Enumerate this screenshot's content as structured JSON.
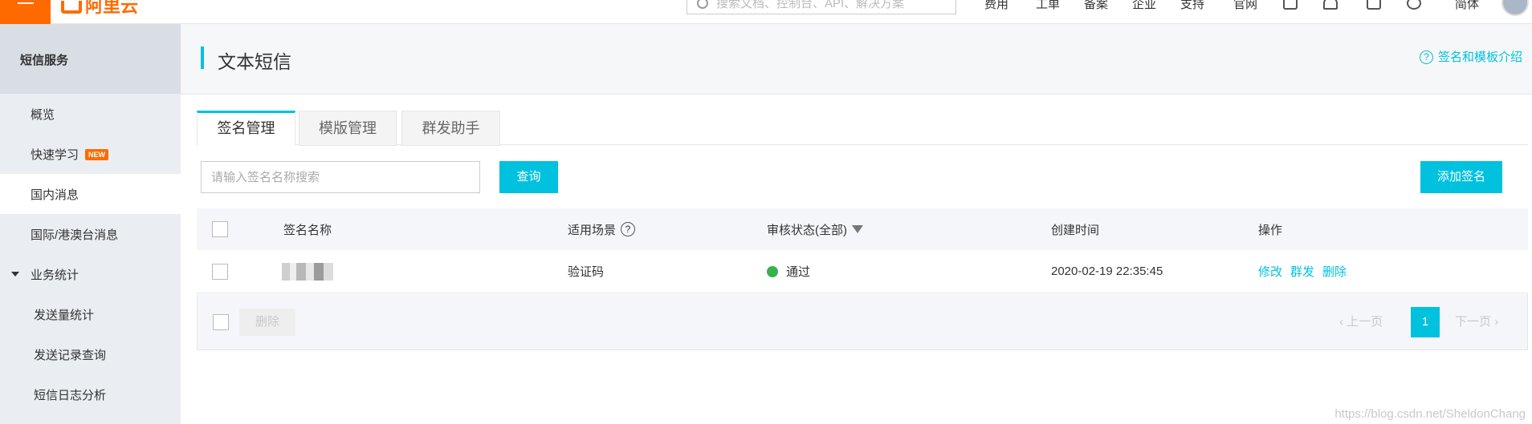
{
  "topbar": {
    "logo_text": "阿里云",
    "search_placeholder": "搜索文档、控制台、API、解决方案",
    "nav": [
      "费用",
      "工单",
      "备案",
      "企业",
      "支持",
      "官网"
    ],
    "lang": "简体"
  },
  "sidebar": {
    "title": "短信服务",
    "items": [
      {
        "label": "概览"
      },
      {
        "label": "快速学习",
        "badge": "NEW"
      },
      {
        "label": "国内消息"
      },
      {
        "label": "国际/港澳台消息"
      },
      {
        "label": "业务统计"
      },
      {
        "label": "发送量统计"
      },
      {
        "label": "发送记录查询"
      },
      {
        "label": "短信日志分析"
      }
    ]
  },
  "header": {
    "title": "文本短信",
    "help_link": "签名和模板介绍",
    "help_icon": "?"
  },
  "tabs": [
    {
      "label": "签名管理",
      "active": true
    },
    {
      "label": "模版管理",
      "active": false
    },
    {
      "label": "群发助手",
      "active": false
    }
  ],
  "toolbar": {
    "search_placeholder": "请输入签名名称搜索",
    "search_button": "查询",
    "add_button": "添加签名"
  },
  "table": {
    "columns": [
      "签名名称",
      "适用场景",
      "审核状态(全部)",
      "创建时间",
      "操作"
    ],
    "help_icon": "?",
    "rows": [
      {
        "scene": "验证码",
        "status": "通过",
        "status_color": "#35b34a",
        "created": "2020-02-19 22:35:45",
        "actions": [
          "修改",
          "群发",
          "删除"
        ]
      }
    ]
  },
  "footer": {
    "delete_button": "删除",
    "prev": "上一页",
    "next": "下一页",
    "page": "1"
  },
  "watermark": "https://blog.csdn.net/SheldonChang",
  "colors": {
    "accent": "#00c1de",
    "brand": "#ff6a00"
  }
}
